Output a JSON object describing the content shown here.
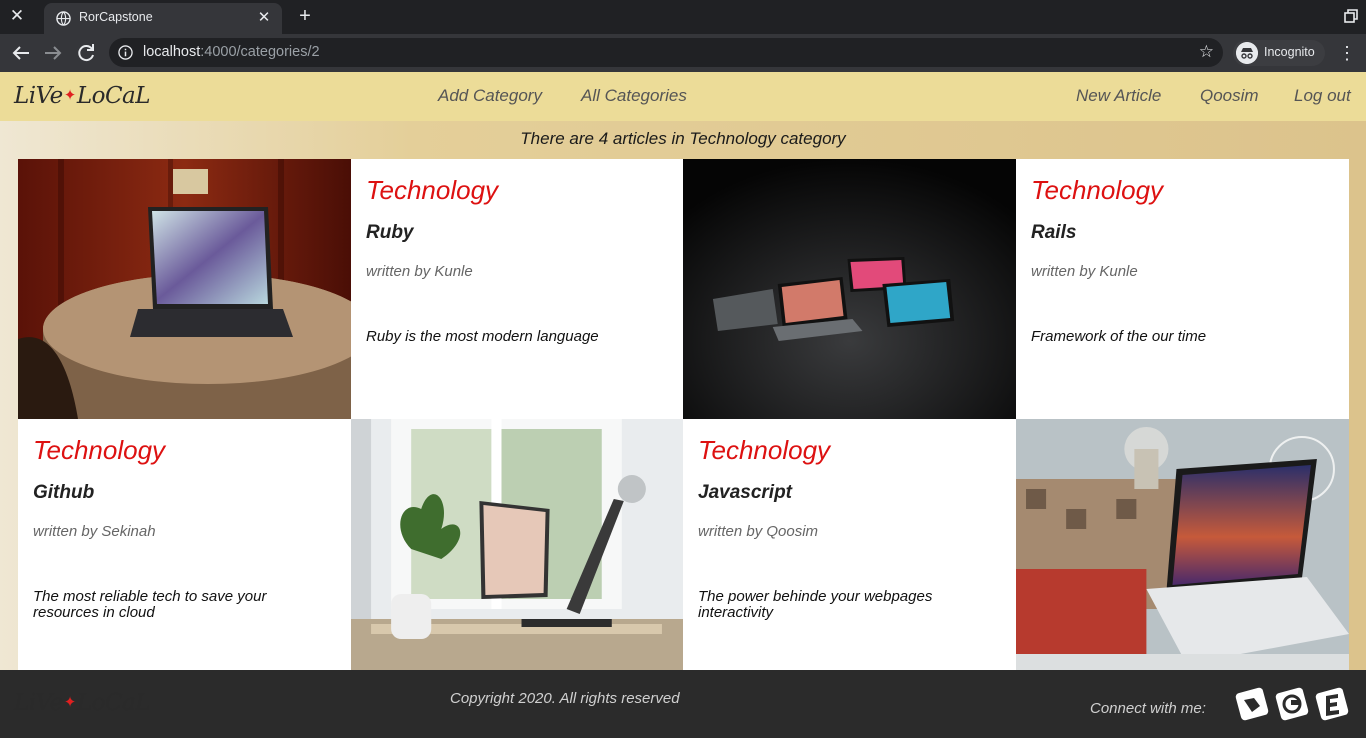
{
  "browser": {
    "tab_title": "RorCapstone",
    "url_host": "localhost",
    "url_rest": ":4000/categories/2",
    "profile_label": "Incognito"
  },
  "site": {
    "logo_left": "LiVe",
    "logo_right": "LoCaL",
    "nav": {
      "add_category": "Add Category",
      "all_categories": "All Categories",
      "new_article": "New Article",
      "user": "Qoosim",
      "logout": "Log out"
    },
    "headline": "There are 4 articles in Technology category",
    "articles": [
      {
        "category": "Technology",
        "title": "Ruby",
        "author": "written by Kunle",
        "text": "Ruby is the most modern language"
      },
      {
        "category": "Technology",
        "title": "Rails",
        "author": "written by Kunle",
        "text": "Framework of the our time"
      },
      {
        "category": "Technology",
        "title": "Github",
        "author": "written by Sekinah",
        "text": "The most reliable tech to save your resources in cloud"
      },
      {
        "category": "Technology",
        "title": "Javascript",
        "author": "written by Qoosim",
        "text": "The power behinde your webpages interactivity"
      }
    ],
    "footer": {
      "copyright": "Copyright 2020. All rights reserved",
      "connect": "Connect with me:"
    },
    "colors": {
      "accent_red": "#dd1111",
      "header_bg": "#ecdc98",
      "footer_bg": "#2b2b2b"
    }
  }
}
